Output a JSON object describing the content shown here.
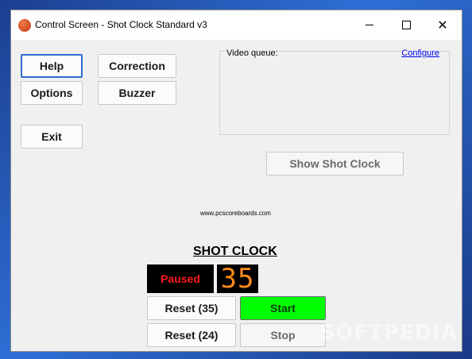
{
  "window": {
    "title": "Control Screen - Shot Clock Standard v3"
  },
  "buttons": {
    "help": "Help",
    "correction": "Correction",
    "options": "Options",
    "buzzer": "Buzzer",
    "exit": "Exit",
    "show_shot_clock": "Show Shot Clock"
  },
  "video_queue": {
    "label": "Video queue:",
    "configure": "Configure"
  },
  "website": "www.pcscoreboards.com",
  "shot_clock": {
    "title": "SHOT CLOCK",
    "status": "Paused",
    "time": "35",
    "reset35": "Reset (35)",
    "reset24": "Reset (24)",
    "start": "Start",
    "stop": "Stop"
  },
  "colors": {
    "status_text": "#ff1a1a",
    "clock_digits": "#ff8a1a",
    "start_button": "#00ff00",
    "link": "#0000ee"
  },
  "watermark": "SOFTPEDIA"
}
